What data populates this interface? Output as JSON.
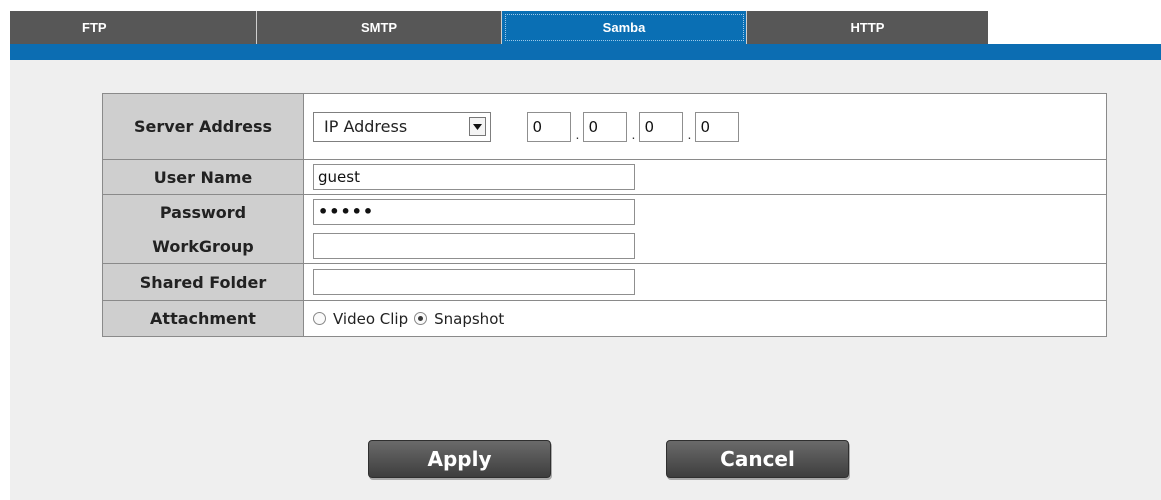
{
  "tabs": [
    {
      "label": "FTP",
      "active": false
    },
    {
      "label": "SMTP",
      "active": false
    },
    {
      "label": "Samba",
      "active": true
    },
    {
      "label": "HTTP",
      "active": false
    }
  ],
  "colors": {
    "accent": "#0c6db2",
    "tab_bg": "#575757",
    "label_bg": "#cfcfcf",
    "page_bg": "#efefef"
  },
  "form": {
    "server_address": {
      "label": "Server Address",
      "type_selected": "IP Address",
      "ip": [
        "0",
        "0",
        "0",
        "0"
      ]
    },
    "user_name": {
      "label": "User Name",
      "value": "guest"
    },
    "password": {
      "label": "Password",
      "value": "•••••"
    },
    "workgroup": {
      "label": "WorkGroup",
      "value": ""
    },
    "shared_folder": {
      "label": "Shared Folder",
      "value": ""
    },
    "attachment": {
      "label": "Attachment",
      "options": [
        {
          "label": "Video Clip",
          "selected": false
        },
        {
          "label": "Snapshot",
          "selected": true
        }
      ]
    }
  },
  "buttons": {
    "apply": "Apply",
    "cancel": "Cancel"
  },
  "icons": {
    "select_arrow": "chevron-down-icon"
  }
}
